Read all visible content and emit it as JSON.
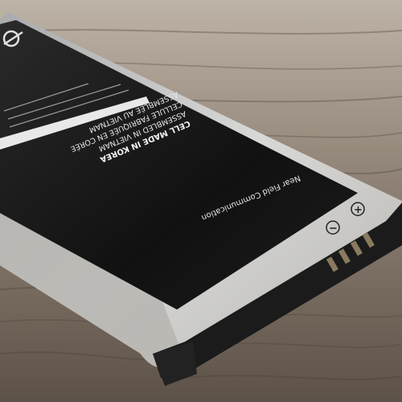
{
  "battery": {
    "label_lines": [
      "CELL MADE IN KOREA",
      "ASSEMBLED IN VIETNAM",
      "CELLULE FABRIQUÉE EN CORÉE",
      "ASSEMBLÉE AU VIETNAM",
      "ASSEMBLÉ AU VIETNAM"
    ],
    "nfc_text": "Near Field Communication",
    "terminal_plus": "+",
    "terminal_minus": "−"
  },
  "colors": {
    "wood_light": "#9c8f80",
    "wood_dark": "#5b5046",
    "casing_silver": "#c9c9c7",
    "label_black": "#141414",
    "connector_black": "#1b1b1b"
  }
}
